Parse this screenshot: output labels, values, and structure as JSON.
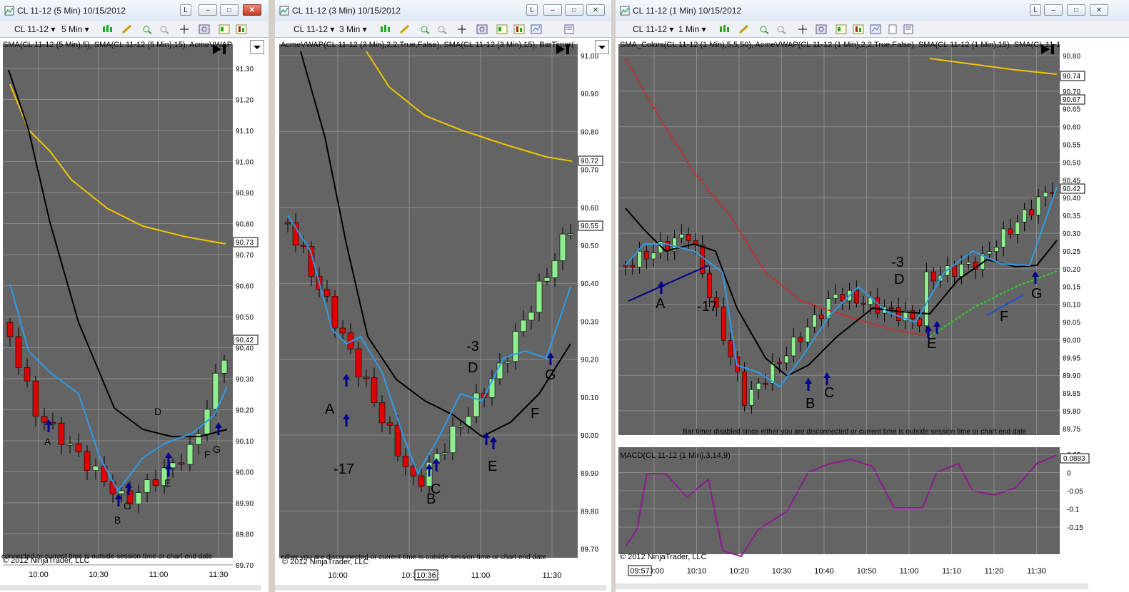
{
  "windows": [
    {
      "title": "CL 11-12 (5 Min)  10/15/2012",
      "instrument": "CL 11-12",
      "interval": "5 Min",
      "indicator_label": "SMA(CL 11-12 (5 Min),5), SMA(CL 11-12 (5 Min),15), AcmeVWAP",
      "status": "connected or current time is outside session time or chart end date",
      "copyright": "© 2012 NinjaTrader, LLC",
      "y_ticks": [
        "91.30",
        "91.20",
        "91.10",
        "91.00",
        "90.90",
        "90.80",
        "90.70",
        "90.60",
        "90.50",
        "90.40",
        "90.30",
        "90.20",
        "90.10",
        "90.00",
        "89.90",
        "89.80",
        "89.70"
      ],
      "x_ticks": [
        "10:00",
        "10:30",
        "11:00",
        "11:30"
      ],
      "price_boxes": [
        "90.73",
        "90.42"
      ],
      "annotations": [
        "A",
        "B",
        "C",
        "D",
        "E",
        "F",
        "G"
      ]
    },
    {
      "title": "CL 11-12 (3 Min)  10/15/2012",
      "instrument": "CL 11-12",
      "interval": "3 Min",
      "indicator_label": "AcmeVWAP(CL 11-12 (3 Min),2,2,True,False), SMA(CL 11-12 (3 Min),15), BarTimer(",
      "status": "either you are disconnected or current time is outside session time or chart end date",
      "copyright": "© 2012 NinjaTrader, LLC",
      "y_ticks": [
        "91.00",
        "90.90",
        "90.80",
        "90.70",
        "90.60",
        "90.50",
        "90.40",
        "90.30",
        "90.20",
        "90.10",
        "90.00",
        "89.90",
        "89.80",
        "89.70"
      ],
      "x_ticks": [
        "10:00",
        "10:3",
        "11:00",
        "11:30"
      ],
      "cursor_time": "10:36",
      "price_boxes": [
        "90.72",
        "90.55"
      ],
      "annotations": [
        "A",
        "-17",
        "B",
        "C",
        "-3",
        "D",
        "E",
        "F",
        "G"
      ]
    },
    {
      "title": "CL 11-12 (1 Min)  10/15/2012",
      "instrument": "CL 11-12",
      "interval": "1 Min",
      "indicator_label": "SMA_Colors(CL 11-12 (1 Min),5,5,50), AcmeVWAP(CL 11-12 (1 Min),2,2,True,False), SMA(CL 11-12 (1 Min),15), SMA(CL 11-12",
      "status": "Bar timer disabled since either you are disconnected or current time is outside session time or chart end date",
      "copyright": "© 2012 NinjaTrader, LLC",
      "macd_label": "MACD(CL 11-12 (1 Min),3,14,9)",
      "y_ticks": [
        "90.80",
        "90.75",
        "90.70",
        "90.65",
        "90.60",
        "90.55",
        "90.50",
        "90.45",
        "90.40",
        "90.35",
        "90.30",
        "90.25",
        "90.20",
        "90.15",
        "90.10",
        "90.05",
        "90.00",
        "89.95",
        "89.90",
        "89.85",
        "89.80",
        "89.75"
      ],
      "macd_ticks": [
        "0.05",
        "0",
        "-0.05",
        "-0.1",
        "-0.15"
      ],
      "x_ticks": [
        "10:00",
        "10:10",
        "10:20",
        "10:30",
        "10:40",
        "10:50",
        "11:00",
        "11:10",
        "11:20",
        "11:30"
      ],
      "cursor_time": "09:57",
      "price_boxes": [
        "90.74",
        "90.67",
        "90.42"
      ],
      "macd_box": "0.0883",
      "annotations": [
        "A",
        "-17",
        "B",
        "C",
        "-3",
        "D",
        "E",
        "F",
        "G"
      ]
    }
  ],
  "colors": {
    "chart_bg": "#646464",
    "grid": "#8c8c8c",
    "sma_fast": "#2f9be8",
    "sma_slow": "#000000",
    "vwap": "#f2c500",
    "up_bar": "#90ee90",
    "down_bar": "#e00000",
    "macd": "#8a1a8e",
    "arrow": "#00008b",
    "trend_red": "#e02020",
    "trend_green": "#33cc33"
  }
}
